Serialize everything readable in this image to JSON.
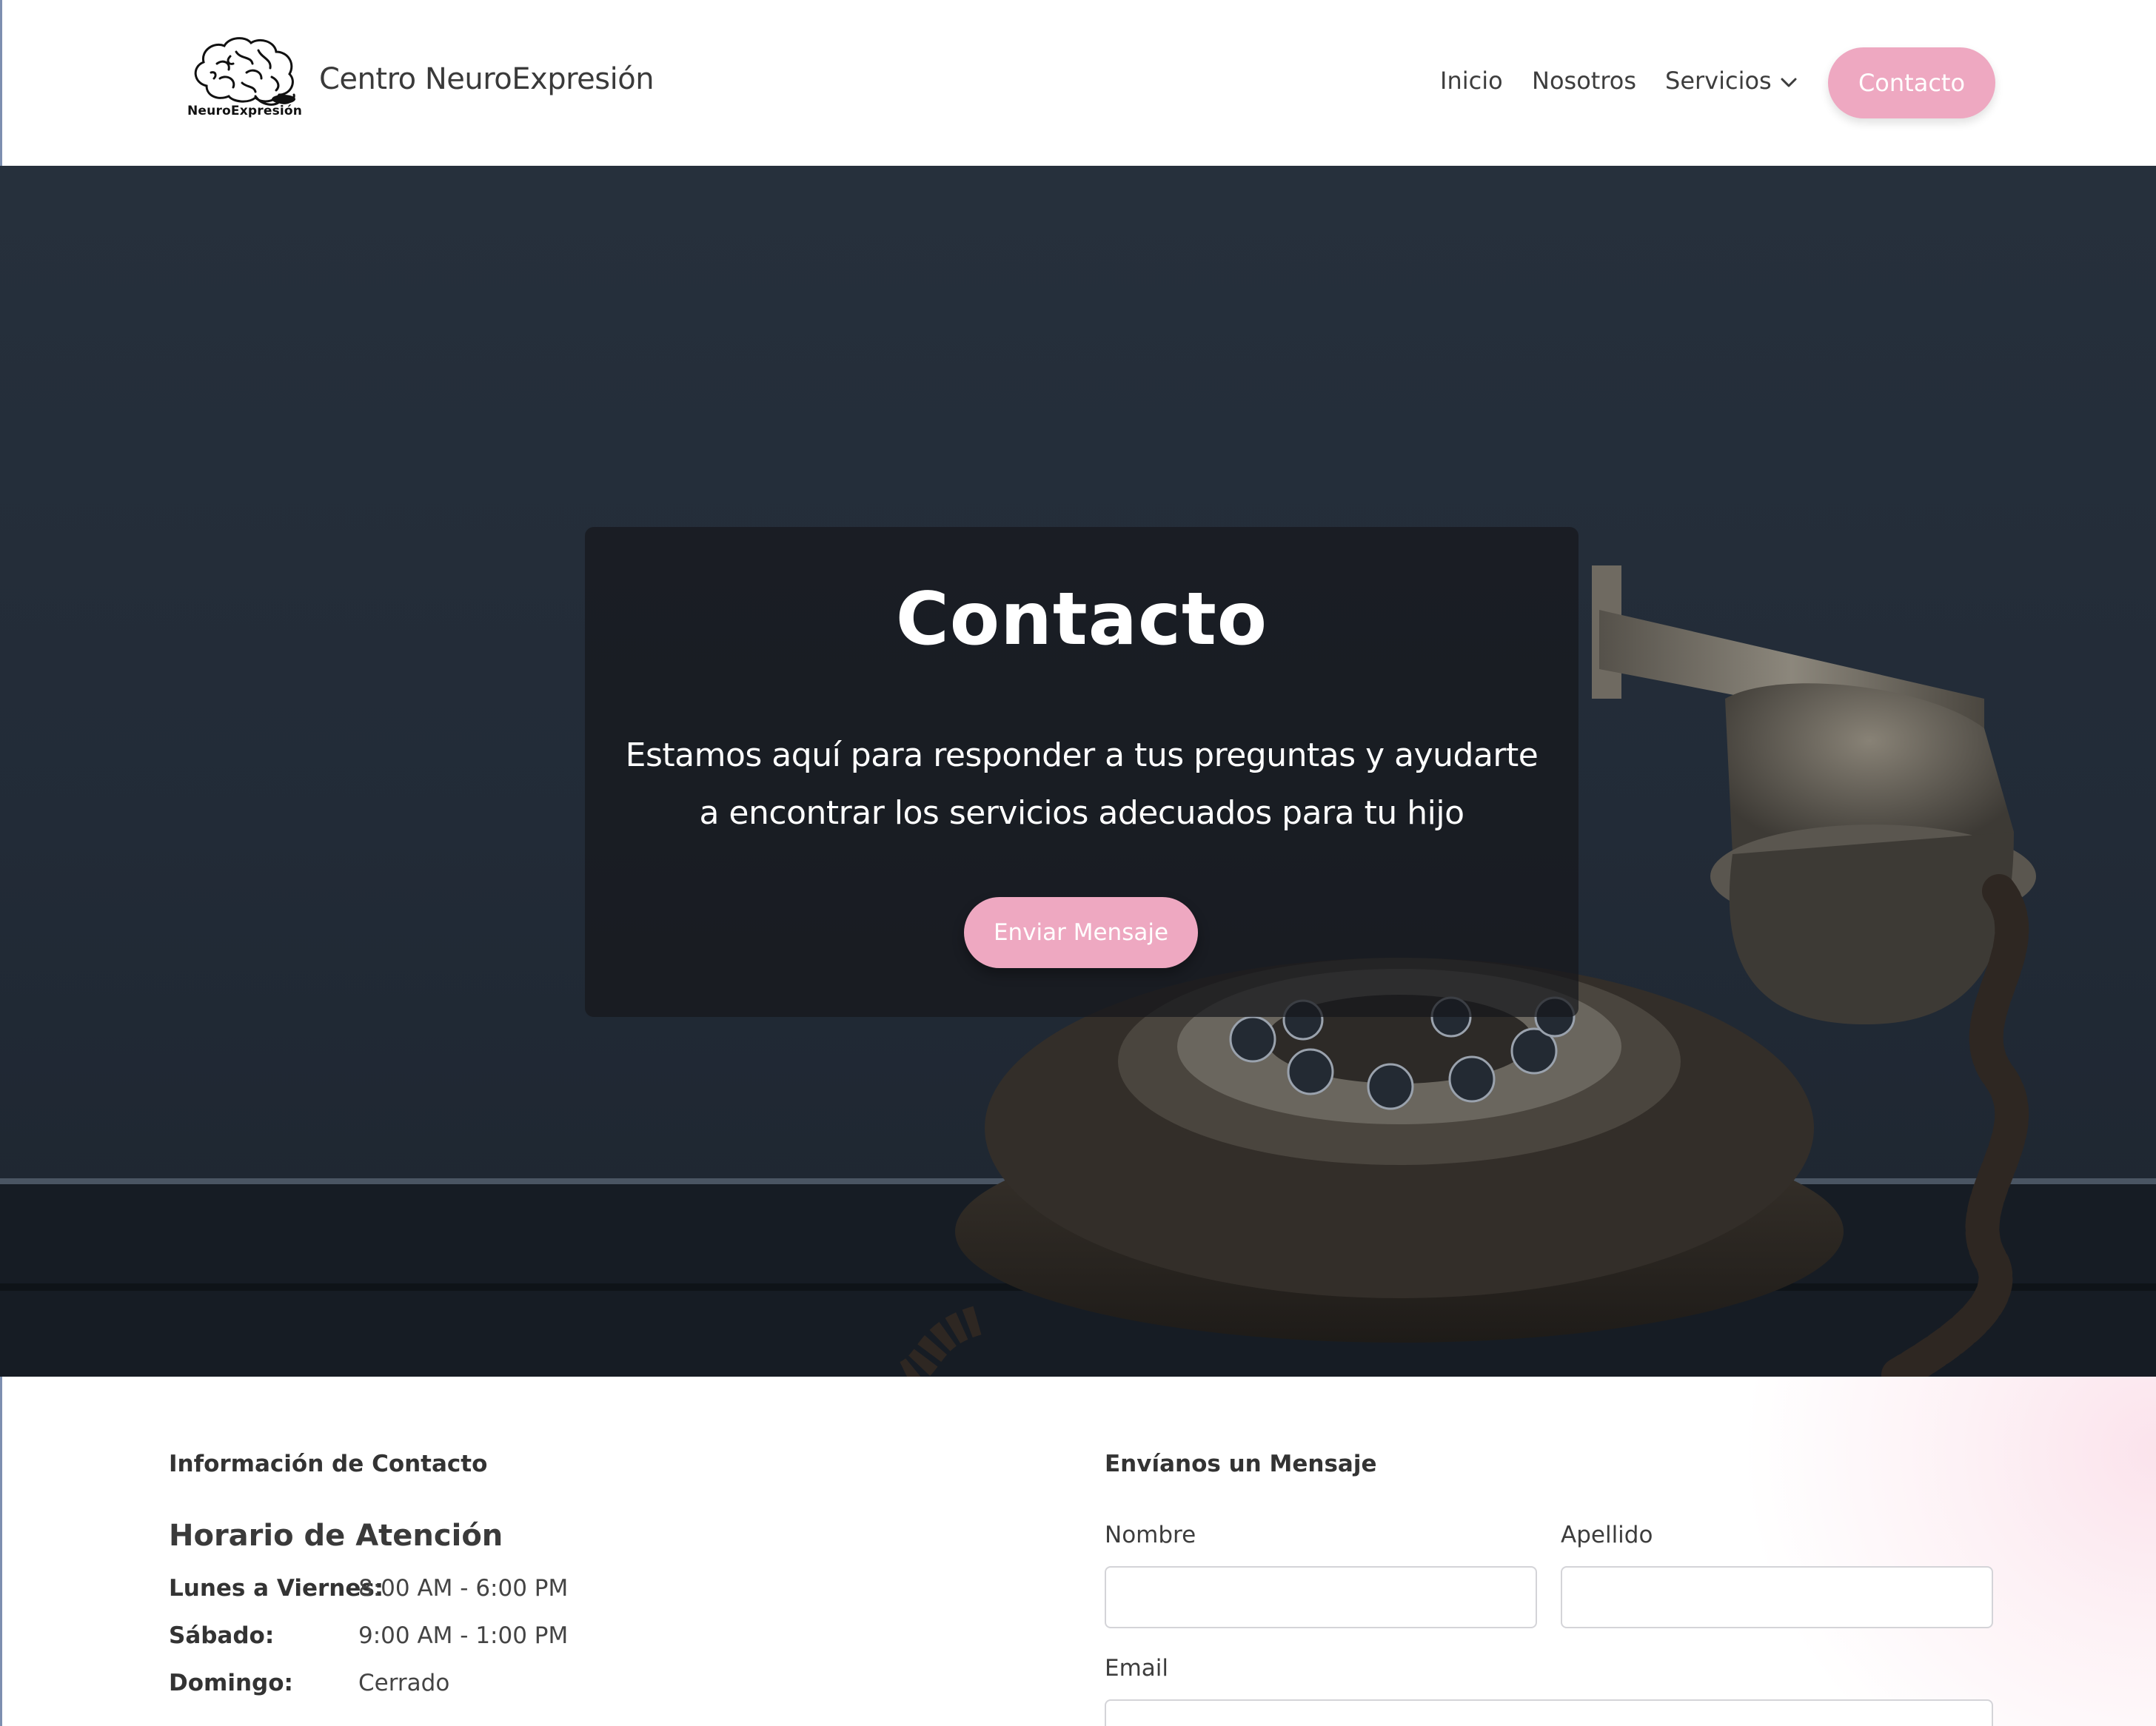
{
  "header": {
    "logo_text": "NeuroExpresión",
    "brand": "Centro NeuroExpresión",
    "nav": {
      "inicio": "Inicio",
      "nosotros": "Nosotros",
      "servicios": "Servicios",
      "contacto_button": "Contacto"
    }
  },
  "hero": {
    "title": "Contacto",
    "subtitle_line1": "Estamos aquí para responder a tus preguntas y ayudarte",
    "subtitle_line2": "a encontrar los servicios adecuados para tu hijo",
    "cta": "Enviar Mensaje"
  },
  "contact_info": {
    "section_title": "Información de Contacto",
    "hours_title": "Horario de Atención",
    "rows": [
      {
        "day": "Lunes a Viernes:",
        "time": "8:00 AM - 6:00 PM"
      },
      {
        "day": "Sábado:",
        "time": "9:00 AM - 1:00 PM"
      },
      {
        "day": "Domingo:",
        "time": "Cerrado"
      }
    ]
  },
  "form": {
    "section_title": "Envíanos un Mensaje",
    "nombre_label": "Nombre",
    "apellido_label": "Apellido",
    "email_label": "Email",
    "nombre_value": "",
    "apellido_value": "",
    "email_value": ""
  },
  "colors": {
    "accent_pink": "#eea8c1",
    "hero_dark": "#222b37",
    "text_dark": "#333333"
  },
  "icons": [
    "brain-logo-icon",
    "chevron-down-icon"
  ]
}
